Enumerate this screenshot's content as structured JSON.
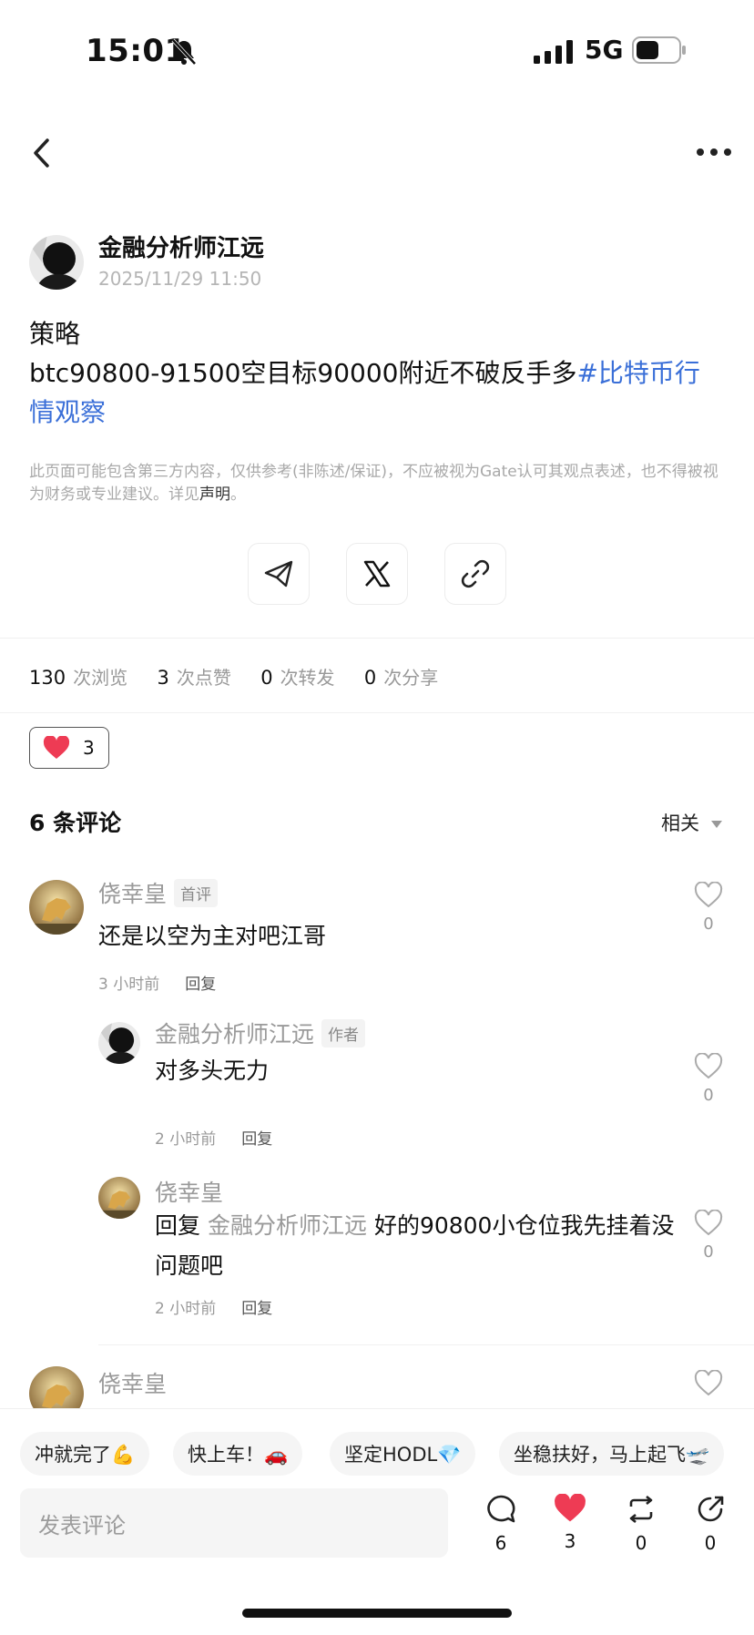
{
  "status": {
    "time": "15:01",
    "network": "5G"
  },
  "post": {
    "author": "金融分析师江远",
    "time": "2025/11/29 11:50",
    "line1": "策略",
    "line2": "btc90800-91500空目标90000附近不破反手多",
    "hashtag": "#比特币行情观察",
    "disclaimer_text": "此页面可能包含第三方内容，仅供参考(非陈述/保证)，不应被视为Gate认可其观点表述，也不得被视为财务或专业建议。详见",
    "disclaimer_link": "声明",
    "disclaimer_end": "。"
  },
  "share": [
    "telegram-icon",
    "x-icon",
    "link-icon"
  ],
  "stats": {
    "views": "130",
    "views_label": "次浏览",
    "likes": "3",
    "likes_label": "次点赞",
    "reposts": "0",
    "reposts_label": "次转发",
    "shares": "0",
    "shares_label": "次分享"
  },
  "reaction": {
    "count": "3"
  },
  "comments_header": {
    "title": "6 条评论",
    "sort": "相关"
  },
  "comments": [
    {
      "name": "侥幸皇",
      "badge": "首评",
      "text": "还是以空为主对吧江哥",
      "time": "3 小时前",
      "reply": "回复",
      "likes": "0"
    },
    {
      "name": "金融分析师江远",
      "badge": "作者",
      "text": "对多头无力",
      "time": "2 小时前",
      "reply": "回复",
      "likes": "0"
    },
    {
      "name": "侥幸皇",
      "reply_prefix": "回复",
      "mention": "金融分析师江远",
      "text": "好的90800小仓位我先挂着没问题吧",
      "time": "2 小时前",
      "reply": "回复",
      "likes": "0"
    },
    {
      "name": "侥幸皇"
    }
  ],
  "quick_replies": [
    "冲就完了💪",
    "快上车！🚗",
    "坚定HODL💎",
    "坐稳扶好，马上起飞🛫"
  ],
  "bottom": {
    "placeholder": "发表评论",
    "comment_count": "6",
    "like_count": "3",
    "repost_count": "0",
    "share_count": "0"
  },
  "colors": {
    "accent": "#3a6fd8",
    "like": "#ee3b54"
  }
}
